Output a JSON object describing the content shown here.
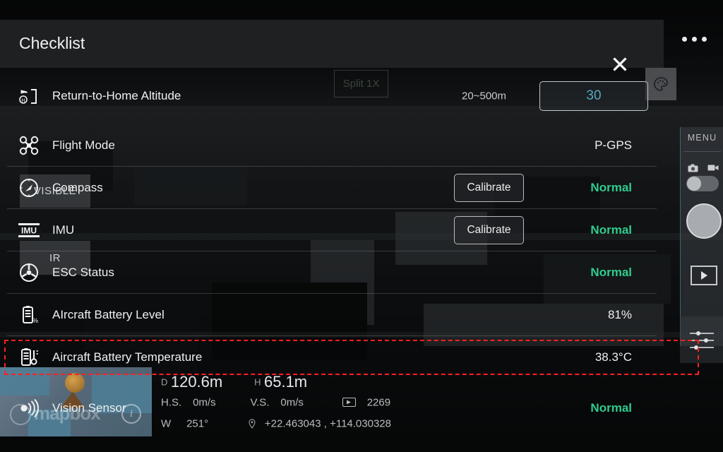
{
  "dialog": {
    "title": "Checklist",
    "close_icon": "close-icon",
    "more_icon": "more-options-icon",
    "rows": [
      {
        "icon": "return-to-home-altitude-icon",
        "label": "Return-to-Home Altitude",
        "range": "20~500m",
        "input_value": "30",
        "control": "number"
      },
      {
        "icon": "drone-icon",
        "label": "Flight Mode",
        "value": "P-GPS",
        "control": "value"
      },
      {
        "icon": "compass-icon",
        "label": "Compass",
        "button": "Calibrate",
        "value": "Normal",
        "status": "ok",
        "control": "calibrate"
      },
      {
        "icon": "imu-icon",
        "label": "IMU",
        "button": "Calibrate",
        "value": "Normal",
        "status": "ok",
        "control": "calibrate"
      },
      {
        "icon": "esc-icon",
        "label": "ESC Status",
        "value": "Normal",
        "status": "ok",
        "control": "value"
      },
      {
        "icon": "battery-percent-icon",
        "label": "AIrcraft Battery Level",
        "value": "81%",
        "control": "value"
      },
      {
        "icon": "battery-temperature-icon",
        "label": "Aircraft Battery Temperature",
        "value": "38.3°C",
        "control": "value",
        "highlighted": true
      },
      {
        "icon": "vision-sensor-icon",
        "label": "Vision Sensor",
        "value": "Normal",
        "status": "ok",
        "control": "value"
      }
    ]
  },
  "background": {
    "split_button": "Split 1X",
    "palette_icon": "color-palette-icon",
    "visible_button": "VISIBLE",
    "ir_button": "IR",
    "rail": {
      "menu_label": "MENU",
      "photo_icon": "camera-photo-icon",
      "video_icon": "camera-video-icon",
      "mode_toggle": "photo-video-toggle",
      "shutter": "shutter-button",
      "playback_icon": "playback-icon",
      "settings_icon": "sliders-settings-icon"
    },
    "minimap": {
      "watermark": "mapbox",
      "info_icon": "map-info-icon"
    }
  },
  "telemetry": {
    "distance_label": "D",
    "distance": "120.6m",
    "height_label": "H",
    "height": "65.1m",
    "hspeed_label": "H.S.",
    "hspeed": "0m/s",
    "vspeed_label": "V.S.",
    "vspeed": "0m/s",
    "sd_icon": "sd-card-icon",
    "sd_value": "2269",
    "wind_label": "W",
    "wind": "251°",
    "gps_icon": "gps-pin-icon",
    "coords": "+22.463043 , +114.030328"
  },
  "colors": {
    "status_ok": "#2ecd8e",
    "highlight": "#ff2020",
    "input_text": "#55a7c0",
    "dialog_header": "#1f2022"
  }
}
